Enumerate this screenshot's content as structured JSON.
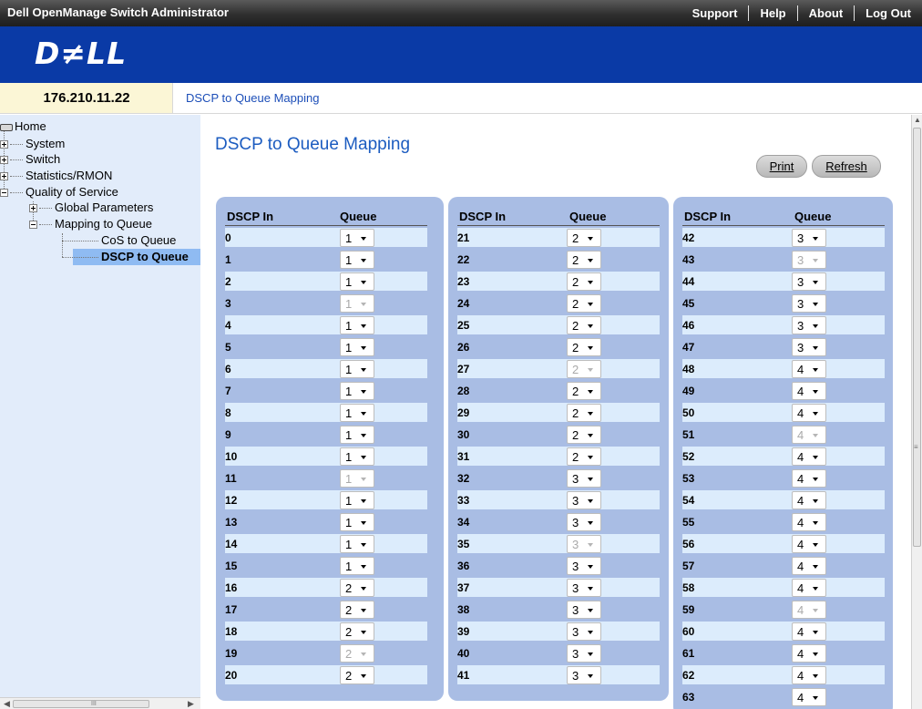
{
  "app_title": "Dell OpenManage Switch Administrator",
  "top_links": [
    "Support",
    "Help",
    "About",
    "Log Out"
  ],
  "logo_text": "D≠LL",
  "ip_address": "176.210.11.22",
  "breadcrumb": "DSCP to Queue Mapping",
  "page_title": "DSCP to Queue Mapping",
  "buttons": {
    "print": "Print",
    "refresh": "Refresh"
  },
  "tree": {
    "home": "Home",
    "system": "System",
    "switch": "Switch",
    "statistics": "Statistics/RMON",
    "qos": "Quality of Service",
    "global_params": "Global Parameters",
    "mapping": "Mapping to Queue",
    "cos": "CoS to Queue",
    "dscp": "DSCP to Queue"
  },
  "table_headers": {
    "dscp_in": "DSCP In",
    "queue": "Queue"
  },
  "columns": [
    [
      {
        "dscp": "0",
        "queue": "1"
      },
      {
        "dscp": "1",
        "queue": "1"
      },
      {
        "dscp": "2",
        "queue": "1"
      },
      {
        "dscp": "3",
        "queue": "1",
        "disabled": true
      },
      {
        "dscp": "4",
        "queue": "1"
      },
      {
        "dscp": "5",
        "queue": "1"
      },
      {
        "dscp": "6",
        "queue": "1"
      },
      {
        "dscp": "7",
        "queue": "1"
      },
      {
        "dscp": "8",
        "queue": "1"
      },
      {
        "dscp": "9",
        "queue": "1"
      },
      {
        "dscp": "10",
        "queue": "1"
      },
      {
        "dscp": "11",
        "queue": "1",
        "disabled": true
      },
      {
        "dscp": "12",
        "queue": "1"
      },
      {
        "dscp": "13",
        "queue": "1"
      },
      {
        "dscp": "14",
        "queue": "1"
      },
      {
        "dscp": "15",
        "queue": "1"
      },
      {
        "dscp": "16",
        "queue": "2"
      },
      {
        "dscp": "17",
        "queue": "2"
      },
      {
        "dscp": "18",
        "queue": "2"
      },
      {
        "dscp": "19",
        "queue": "2",
        "disabled": true
      },
      {
        "dscp": "20",
        "queue": "2"
      }
    ],
    [
      {
        "dscp": "21",
        "queue": "2"
      },
      {
        "dscp": "22",
        "queue": "2"
      },
      {
        "dscp": "23",
        "queue": "2"
      },
      {
        "dscp": "24",
        "queue": "2"
      },
      {
        "dscp": "25",
        "queue": "2"
      },
      {
        "dscp": "26",
        "queue": "2"
      },
      {
        "dscp": "27",
        "queue": "2",
        "disabled": true
      },
      {
        "dscp": "28",
        "queue": "2"
      },
      {
        "dscp": "29",
        "queue": "2"
      },
      {
        "dscp": "30",
        "queue": "2"
      },
      {
        "dscp": "31",
        "queue": "2"
      },
      {
        "dscp": "32",
        "queue": "3"
      },
      {
        "dscp": "33",
        "queue": "3"
      },
      {
        "dscp": "34",
        "queue": "3"
      },
      {
        "dscp": "35",
        "queue": "3",
        "disabled": true
      },
      {
        "dscp": "36",
        "queue": "3"
      },
      {
        "dscp": "37",
        "queue": "3"
      },
      {
        "dscp": "38",
        "queue": "3"
      },
      {
        "dscp": "39",
        "queue": "3"
      },
      {
        "dscp": "40",
        "queue": "3"
      },
      {
        "dscp": "41",
        "queue": "3"
      }
    ],
    [
      {
        "dscp": "42",
        "queue": "3"
      },
      {
        "dscp": "43",
        "queue": "3",
        "disabled": true
      },
      {
        "dscp": "44",
        "queue": "3"
      },
      {
        "dscp": "45",
        "queue": "3"
      },
      {
        "dscp": "46",
        "queue": "3"
      },
      {
        "dscp": "47",
        "queue": "3"
      },
      {
        "dscp": "48",
        "queue": "4"
      },
      {
        "dscp": "49",
        "queue": "4"
      },
      {
        "dscp": "50",
        "queue": "4"
      },
      {
        "dscp": "51",
        "queue": "4",
        "disabled": true
      },
      {
        "dscp": "52",
        "queue": "4"
      },
      {
        "dscp": "53",
        "queue": "4"
      },
      {
        "dscp": "54",
        "queue": "4"
      },
      {
        "dscp": "55",
        "queue": "4"
      },
      {
        "dscp": "56",
        "queue": "4"
      },
      {
        "dscp": "57",
        "queue": "4"
      },
      {
        "dscp": "58",
        "queue": "4"
      },
      {
        "dscp": "59",
        "queue": "4",
        "disabled": true
      },
      {
        "dscp": "60",
        "queue": "4"
      },
      {
        "dscp": "61",
        "queue": "4"
      },
      {
        "dscp": "62",
        "queue": "4"
      },
      {
        "dscp": "63",
        "queue": "4"
      }
    ]
  ],
  "colors": {
    "header_bar": "#2f2f2f",
    "brand_blue": "#0a3aa6",
    "panel_bg": "#a9bde4",
    "row_alt": "#dcecfc",
    "tree_bg": "#e2ecfa",
    "selected": "#8fbbf2",
    "title_blue": "#1c5cc0"
  }
}
